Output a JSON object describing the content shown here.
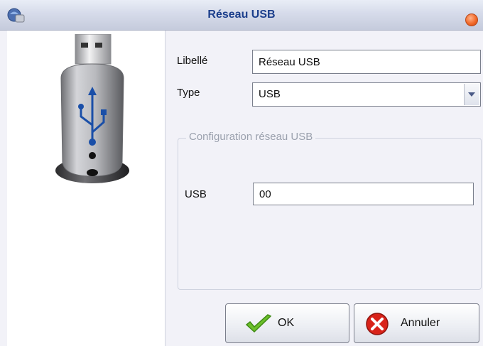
{
  "window": {
    "title": "Réseau USB"
  },
  "form": {
    "libelle_label": "Libellé",
    "libelle_value": "Réseau USB",
    "type_label": "Type",
    "type_value": "USB"
  },
  "group": {
    "legend": "Configuration réseau USB",
    "usb_label": "USB",
    "usb_value": "00"
  },
  "buttons": {
    "ok_label": "OK",
    "cancel_label": "Annuler"
  },
  "colors": {
    "title": "#1c3f8c",
    "close": "#f26a2a",
    "ok_check": "#6bbf2a",
    "cancel_x": "#d9231a"
  }
}
